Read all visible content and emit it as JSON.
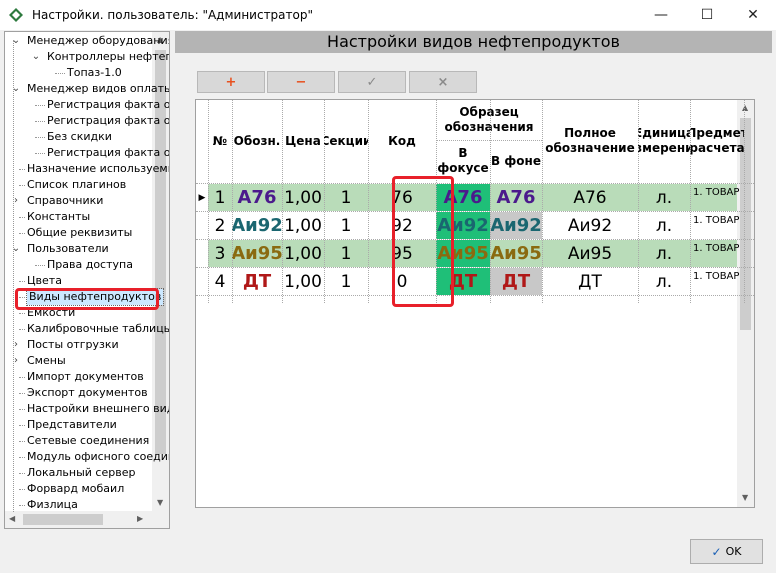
{
  "window": {
    "title": "Настройки. пользователь: \"Администратор\"",
    "minimize_icon": "minimize-icon",
    "maximize_icon": "maximize-icon",
    "close_icon": "close-icon"
  },
  "sidebar": {
    "items": [
      {
        "label": "Менеджер оборудования",
        "toggle": "⌄"
      },
      {
        "label": "Контроллеры нефтепр",
        "toggle": "⌄"
      },
      {
        "label": "Топаз-1.0",
        "toggle": ""
      },
      {
        "label": "Менеджер видов оплаты",
        "toggle": "⌄"
      },
      {
        "label": "Регистрация факта о",
        "toggle": ""
      },
      {
        "label": "Регистрация факта о",
        "toggle": ""
      },
      {
        "label": "Без скидки",
        "toggle": ""
      },
      {
        "label": "Регистрация факта о",
        "toggle": ""
      },
      {
        "label": "Назначение используемы",
        "toggle": ""
      },
      {
        "label": "Список плагинов",
        "toggle": ""
      },
      {
        "label": "Справочники",
        "toggle": "›"
      },
      {
        "label": "Константы",
        "toggle": ""
      },
      {
        "label": "Общие реквизиты",
        "toggle": ""
      },
      {
        "label": "Пользователи",
        "toggle": "⌄"
      },
      {
        "label": "Права доступа",
        "toggle": ""
      },
      {
        "label": "Цвета",
        "toggle": ""
      },
      {
        "label": "Виды нефтепродуктов",
        "toggle": ""
      },
      {
        "label": "Емкости",
        "toggle": ""
      },
      {
        "label": "Калибровочные таблицы",
        "toggle": ""
      },
      {
        "label": "Посты отгрузки",
        "toggle": "›"
      },
      {
        "label": "Смены",
        "toggle": "›"
      },
      {
        "label": "Импорт документов",
        "toggle": ""
      },
      {
        "label": "Экспорт документов",
        "toggle": ""
      },
      {
        "label": "Настройки внешнего вида",
        "toggle": ""
      },
      {
        "label": "Представители",
        "toggle": ""
      },
      {
        "label": "Сетевые соединения",
        "toggle": ""
      },
      {
        "label": "Модуль офисного соедин",
        "toggle": ""
      },
      {
        "label": "Локальный сервер",
        "toggle": ""
      },
      {
        "label": "Форвард мобаил",
        "toggle": ""
      },
      {
        "label": "Физлица",
        "toggle": ""
      }
    ],
    "selected": "Виды нефтепродуктов"
  },
  "main": {
    "title": "Настройки видов нефтепродуктов",
    "toolbar": {
      "add": "+",
      "remove": "−",
      "apply": "✓",
      "cancel": "×"
    },
    "grid": {
      "headers": {
        "num": "№",
        "designation": "Обозн.",
        "price": "Цена",
        "section": "Секции",
        "code": "Код",
        "sample_group_1": "Образец",
        "sample_group_2": "обозначения",
        "focus_1": "В",
        "focus_2": "фокусе",
        "background": "В фоне",
        "full_1": "Полное",
        "full_2": "обозначение",
        "unit_1": "Единица",
        "unit_2": "измерения",
        "subject_1": "Предмет",
        "subject_2": "расчета"
      },
      "row_indicator": "▶",
      "rows": [
        {
          "num": "1",
          "designation": "А76",
          "price": "1,00",
          "section": "1",
          "code": "76",
          "focus": "А76",
          "background": "А76",
          "full": "А76",
          "unit": "л.",
          "subject": "1. ТОВАР",
          "color": "#4b1a8c",
          "row_bg": "#b9dcb9",
          "focus_bg": "#1fbf78",
          "back_bg": "#b9dcb9"
        },
        {
          "num": "2",
          "designation": "Аи92",
          "price": "1,00",
          "section": "1",
          "code": "92",
          "focus": "Аи92",
          "background": "Аи92",
          "full": "Аи92",
          "unit": "л.",
          "subject": "1. ТОВАР",
          "color": "#1a6670",
          "row_bg": "#ffffff",
          "focus_bg": "#1fbf78",
          "back_bg": "#c8c8c8"
        },
        {
          "num": "3",
          "designation": "Аи95",
          "price": "1,00",
          "section": "1",
          "code": "95",
          "focus": "Аи95",
          "background": "Аи95",
          "full": "Аи95",
          "unit": "л.",
          "subject": "1. ТОВАР",
          "color": "#8a6a10",
          "row_bg": "#b9dcb9",
          "focus_bg": "#1fbf78",
          "back_bg": "#b9dcb9"
        },
        {
          "num": "4",
          "designation": "ДТ",
          "price": "1,00",
          "section": "1",
          "code": "0",
          "focus": "ДТ",
          "background": "ДТ",
          "full": "ДТ",
          "unit": "л.",
          "subject": "1. ТОВАР",
          "color": "#b01818",
          "row_bg": "#ffffff",
          "focus_bg": "#1fbf78",
          "back_bg": "#c8c8c8"
        }
      ]
    }
  },
  "footer": {
    "ok_label": "OK",
    "ok_icon": "check-icon"
  },
  "colors": {
    "highlight_red": "#e8202a",
    "header_gray": "#b4b4b4",
    "row_green": "#b9dcb9",
    "focus_green": "#1fbf78"
  }
}
